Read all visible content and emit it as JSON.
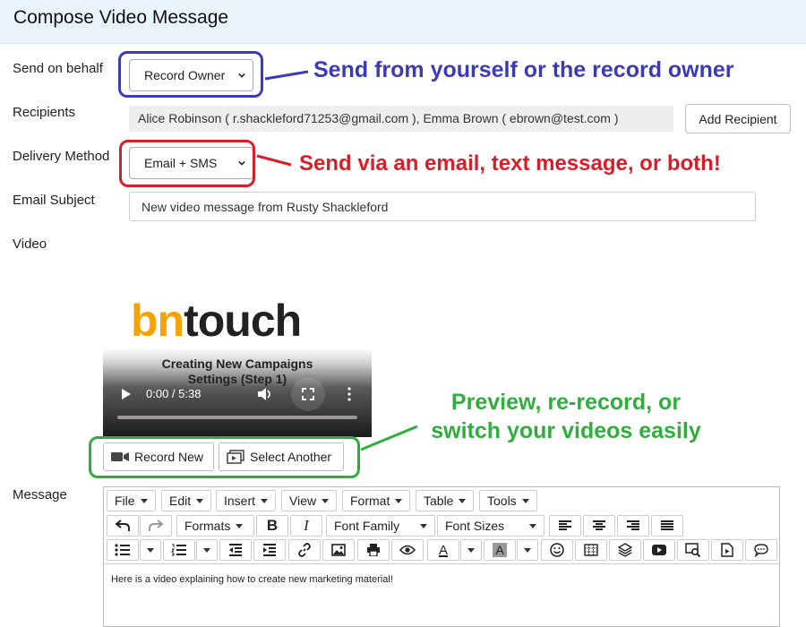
{
  "header": {
    "title": "Compose Video Message"
  },
  "labels": {
    "send_on_behalf": "Send on behalf",
    "recipients": "Recipients",
    "delivery_method": "Delivery Method",
    "email_subject": "Email Subject",
    "video": "Video",
    "message": "Message"
  },
  "send_on_behalf": {
    "selected": "Record Owner"
  },
  "recipients": {
    "value": "Alice Robinson ( r.shackleford71253@gmail.com ), Emma Brown ( ebrown@test.com )",
    "add_button": "Add Recipient"
  },
  "delivery_method": {
    "selected": "Email + SMS"
  },
  "email_subject": {
    "value": "New video message from Rusty Shackleford"
  },
  "video": {
    "logo_part1": "bn",
    "logo_part2": "touch",
    "title_line1": "Creating New Campaigns",
    "title_line2": "Settings (Step 1)",
    "time": "0:00 / 5:38",
    "record_new": "Record New",
    "select_another": "Select Another"
  },
  "annotations": {
    "owner": "Send from yourself or the record owner",
    "delivery": "Send via an email, text message, or both!",
    "preview_line1": "Preview, re-record, or",
    "preview_line2": "switch your videos easily",
    "colors": {
      "blue": "#3b3bb5",
      "red": "#d91e2b",
      "green": "#2fae3e"
    }
  },
  "editor": {
    "menu": {
      "file": "File",
      "edit": "Edit",
      "insert": "Insert",
      "view": "View",
      "format": "Format",
      "table": "Table",
      "tools": "Tools"
    },
    "formats": "Formats",
    "font_family": "Font Family",
    "font_sizes": "Font Sizes",
    "content": "Here is a video explaining how to create new marketing material!"
  }
}
